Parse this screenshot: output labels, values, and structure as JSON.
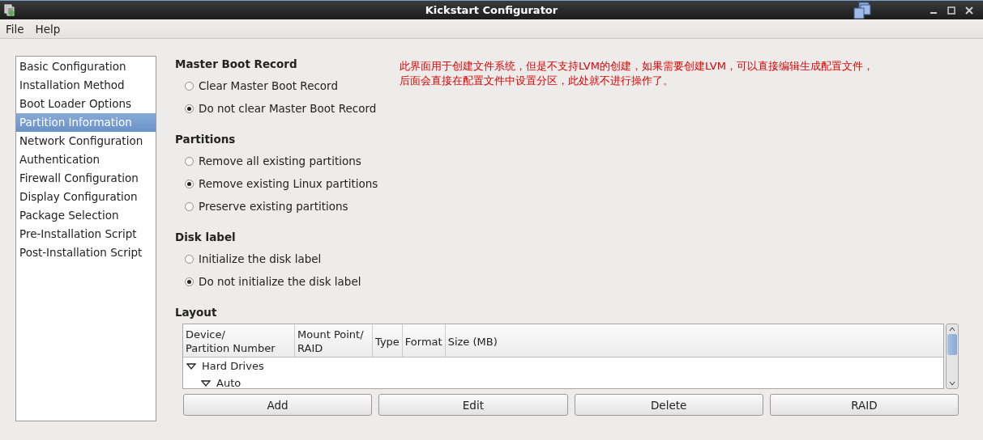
{
  "window": {
    "title": "Kickstart Configurator"
  },
  "menu": [
    "File",
    "Help"
  ],
  "sidebar": {
    "items": [
      {
        "label": "Basic Configuration",
        "selected": false
      },
      {
        "label": "Installation Method",
        "selected": false
      },
      {
        "label": "Boot Loader Options",
        "selected": false
      },
      {
        "label": "Partition Information",
        "selected": true
      },
      {
        "label": "Network Configuration",
        "selected": false
      },
      {
        "label": "Authentication",
        "selected": false
      },
      {
        "label": "Firewall Configuration",
        "selected": false
      },
      {
        "label": "Display Configuration",
        "selected": false
      },
      {
        "label": "Package Selection",
        "selected": false
      },
      {
        "label": "Pre-Installation Script",
        "selected": false
      },
      {
        "label": "Post-Installation Script",
        "selected": false
      }
    ]
  },
  "sections": [
    {
      "title": "Master Boot Record",
      "options": [
        {
          "label": "Clear Master Boot Record",
          "selected": false
        },
        {
          "label": "Do not clear Master Boot Record",
          "selected": true
        }
      ]
    },
    {
      "title": "Partitions",
      "options": [
        {
          "label": "Remove all existing partitions",
          "selected": false
        },
        {
          "label": "Remove existing Linux partitions",
          "selected": true
        },
        {
          "label": "Preserve existing partitions",
          "selected": false
        }
      ]
    },
    {
      "title": "Disk label",
      "options": [
        {
          "label": "Initialize the disk label",
          "selected": false
        },
        {
          "label": "Do not initialize the disk label",
          "selected": true
        }
      ]
    }
  ],
  "annotation": {
    "lines": [
      "此界面用于创建文件系统，但是不支持LVM的创建，如果需要创建LVM，可以直接编辑生成配置文件，",
      "后面会直接在配置文件中设置分区，此处就不进行操作了。"
    ]
  },
  "layout": {
    "title": "Layout",
    "table": {
      "columns": [
        [
          "Device/",
          "Partition Number"
        ],
        [
          "Mount Point/",
          "RAID"
        ],
        [
          "Type"
        ],
        [
          "Format"
        ],
        [
          "Size (MB)"
        ]
      ],
      "tree": [
        {
          "label": "Hard Drives",
          "expanded": true,
          "children": [
            {
              "label": "Auto",
              "expanded": true
            }
          ]
        }
      ]
    },
    "buttons": [
      "Add",
      "Edit",
      "Delete",
      "RAID"
    ]
  }
}
